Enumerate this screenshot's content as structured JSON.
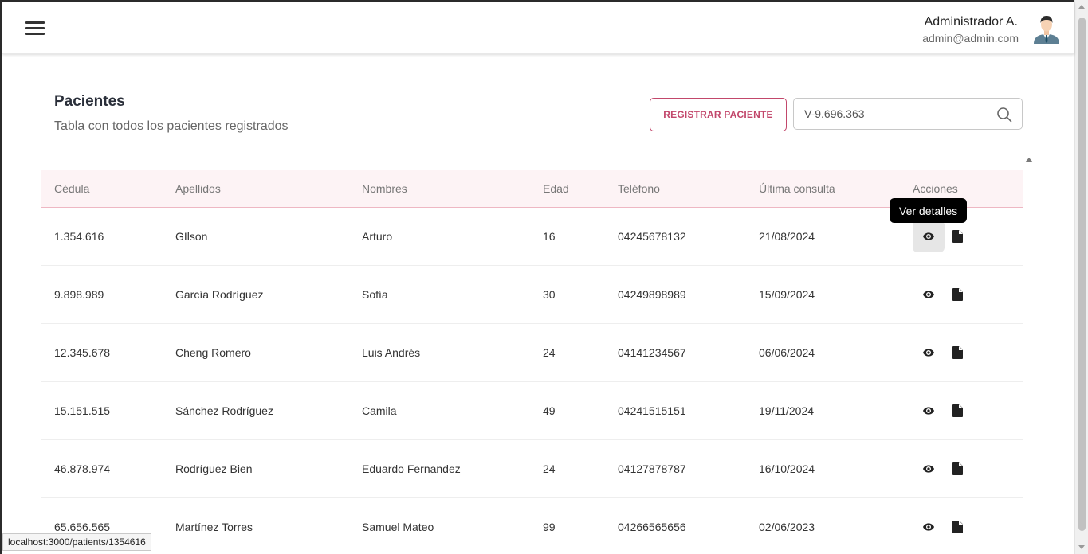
{
  "header": {
    "user_name": "Administrador A.",
    "user_email": "admin@admin.com",
    "menu_icon": "hamburger-menu-icon",
    "avatar_icon": "user-avatar-icon"
  },
  "page": {
    "title": "Pacientes",
    "subtitle": "Tabla con todos los pacientes registrados",
    "register_label": "REGISTRAR PACIENTE",
    "search_value": "V-9.696.363",
    "search_icon": "search-icon"
  },
  "table": {
    "columns": [
      "Cédula",
      "Apellidos",
      "Nombres",
      "Edad",
      "Teléfono",
      "Última consulta",
      "Acciones"
    ],
    "rows": [
      {
        "cedula": "1.354.616",
        "apellidos": "GIlson",
        "nombres": "Arturo",
        "edad": "16",
        "telefono": "04245678132",
        "ultima": "21/08/2024"
      },
      {
        "cedula": "9.898.989",
        "apellidos": "García Rodríguez",
        "nombres": "Sofía",
        "edad": "30",
        "telefono": "04249898989",
        "ultima": "15/09/2024"
      },
      {
        "cedula": "12.345.678",
        "apellidos": "Cheng Romero",
        "nombres": "Luis Andrés",
        "edad": "24",
        "telefono": "04141234567",
        "ultima": "06/06/2024"
      },
      {
        "cedula": "15.151.515",
        "apellidos": "Sánchez Rodríguez",
        "nombres": "Camila",
        "edad": "49",
        "telefono": "04241515151",
        "ultima": "19/11/2024"
      },
      {
        "cedula": "46.878.974",
        "apellidos": "Rodríguez Bien",
        "nombres": "Eduardo Fernandez",
        "edad": "24",
        "telefono": "04127878787",
        "ultima": "16/10/2024"
      },
      {
        "cedula": "65.656.565",
        "apellidos": "Martínez Torres",
        "nombres": "Samuel Mateo",
        "edad": "99",
        "telefono": "04266565656",
        "ultima": "02/06/2023"
      }
    ],
    "action_icons": [
      "eye-icon",
      "document-icon"
    ]
  },
  "tooltip": {
    "text": "Ver detalles"
  },
  "status_bar": {
    "url": "localhost:3000/patients/1354616"
  },
  "colors": {
    "accent": "#c2476b",
    "table_header_bg": "#fdf3f5",
    "table_header_border": "#eeb7c3"
  }
}
